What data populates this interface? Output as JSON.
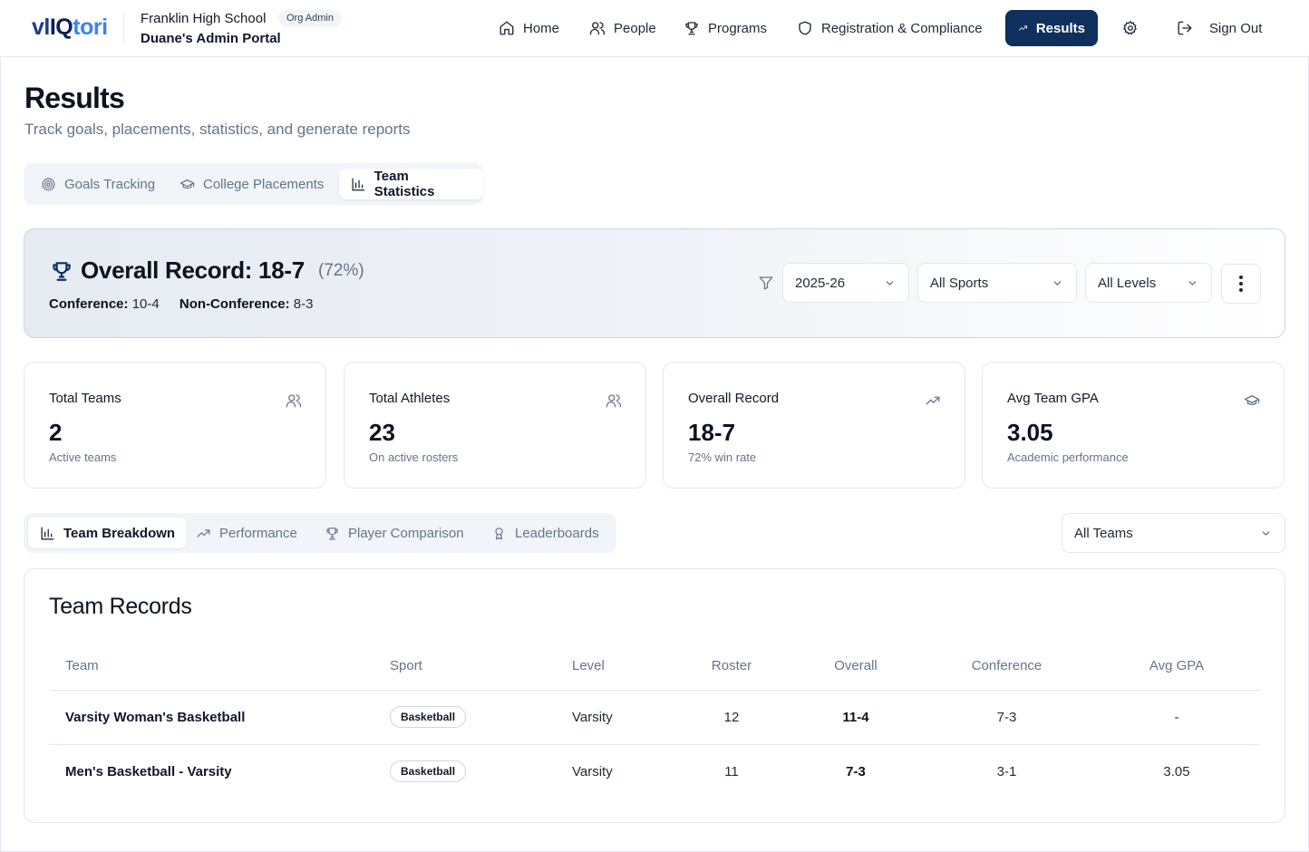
{
  "header": {
    "logo": {
      "part1": "vl",
      "part2": "IQ",
      "part3": "tori"
    },
    "org_name": "Franklin High School",
    "org_badge": "Org Admin",
    "portal_name": "Duane's Admin Portal",
    "nav": {
      "home": "Home",
      "people": "People",
      "programs": "Programs",
      "registration": "Registration & Compliance",
      "results": "Results",
      "sign_out": "Sign Out"
    },
    "active_color": "#0f2f5c"
  },
  "page": {
    "title": "Results",
    "subtitle": "Track goals, placements, statistics, and generate reports"
  },
  "primary_tabs": {
    "goals": "Goals Tracking",
    "placements": "College Placements",
    "statistics": "Team Statistics",
    "active": "statistics"
  },
  "record": {
    "title": "Overall Record: 18-7",
    "pct": "(72%)",
    "conference_label": "Conference:",
    "conference_value": "10-4",
    "nonconf_label": "Non-Conference:",
    "nonconf_value": "8-3"
  },
  "filters": {
    "season": "2025-26",
    "sport": "All Sports",
    "level": "All Levels"
  },
  "stats": [
    {
      "label": "Total Teams",
      "value": "2",
      "desc": "Active teams",
      "icon": "users-icon"
    },
    {
      "label": "Total Athletes",
      "value": "23",
      "desc": "On active rosters",
      "icon": "users-icon"
    },
    {
      "label": "Overall Record",
      "value": "18-7",
      "desc": "72% win rate",
      "icon": "trending-up-icon"
    },
    {
      "label": "Avg Team GPA",
      "value": "3.05",
      "desc": "Academic performance",
      "icon": "graduation-cap-icon"
    }
  ],
  "secondary_tabs": {
    "breakdown": "Team Breakdown",
    "performance": "Performance",
    "comparison": "Player Comparison",
    "leaderboards": "Leaderboards",
    "active": "breakdown"
  },
  "team_filter": "All Teams",
  "table": {
    "title": "Team Records",
    "headers": {
      "team": "Team",
      "sport": "Sport",
      "level": "Level",
      "roster": "Roster",
      "overall": "Overall",
      "conference": "Conference",
      "gpa": "Avg GPA"
    },
    "rows": [
      {
        "team": "Varsity Woman's Basketball",
        "sport": "Basketball",
        "level": "Varsity",
        "roster": "12",
        "overall": "11-4",
        "conference": "7-3",
        "gpa": "-"
      },
      {
        "team": "Men's Basketball - Varsity",
        "sport": "Basketball",
        "level": "Varsity",
        "roster": "11",
        "overall": "7-3",
        "conference": "3-1",
        "gpa": "3.05"
      }
    ]
  }
}
